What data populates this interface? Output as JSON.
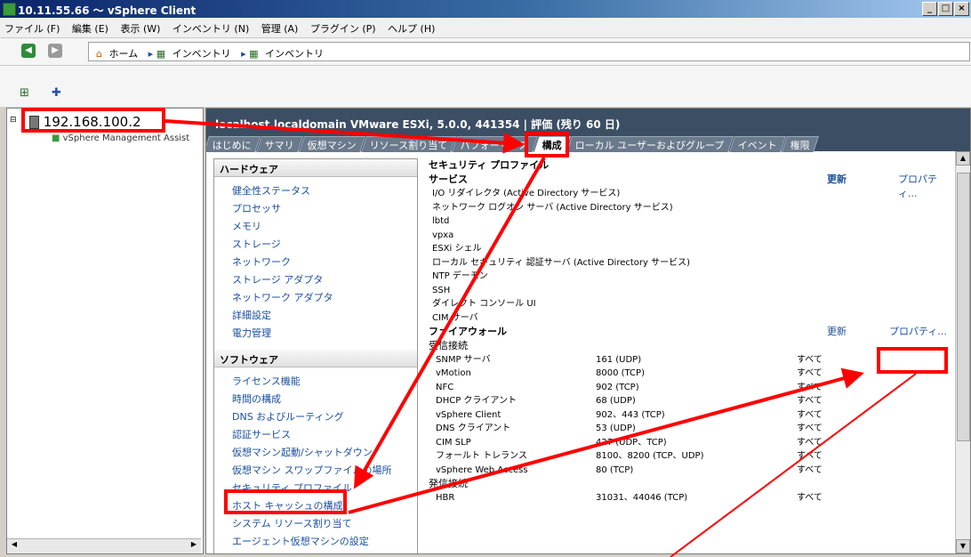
{
  "window": {
    "title": "10.11.55.66 ～ vSphere Client"
  },
  "menu": [
    "ファイル (F)",
    "編集 (E)",
    "表示 (W)",
    "インベントリ (N)",
    "管理 (A)",
    "プラグイン (P)",
    "ヘルプ (H)"
  ],
  "breadcrumb": {
    "home": "ホーム",
    "inv1": "インベントリ",
    "inv2": "インベントリ"
  },
  "tree": {
    "host": "192.168.100.2",
    "vm": "vSphere Management Assist"
  },
  "header": {
    "title": "localhost.localdomain VMware ESXi, 5.0.0, 441354 | 評価 (残り 60 日)"
  },
  "tabs": [
    "はじめに",
    "サマリ",
    "仮想マシン",
    "リソース割り当て",
    "パフォーマンス",
    "構成",
    "ローカル ユーザーおよびグループ",
    "イベント",
    "権限"
  ],
  "hardware": {
    "title": "ハードウェア",
    "items": [
      "健全性ステータス",
      "プロセッサ",
      "メモリ",
      "ストレージ",
      "ネットワーク",
      "ストレージ アダプタ",
      "ネットワーク アダプタ",
      "詳細設定",
      "電力管理"
    ]
  },
  "software": {
    "title": "ソフトウェア",
    "items": [
      "ライセンス機能",
      "時間の構成",
      "DNS およびルーティング",
      "認証サービス",
      "仮想マシン起動/シャットダウン",
      "仮想マシン スワップファイルの場所",
      "セキュリティ プロファイル",
      "ホスト キャッシュの構成",
      "システム リソース割り当て",
      "エージェント仮想マシンの設定"
    ]
  },
  "profile": {
    "title": "セキュリティ プロファイル",
    "services_title": "サービス",
    "refresh": "更新",
    "properties": "プロパティ...",
    "services": [
      "I/O リダイレクタ (Active Directory サービス)",
      "ネットワーク ログオン サーバ (Active Directory サービス)",
      "lbtd",
      "vpxa",
      "ESXi シェル",
      "ローカル セキュリティ 認証サーバ (Active Directory サービス)",
      "NTP デーモン",
      "SSH",
      "ダイレクト コンソール UI",
      "CIM サーバ"
    ],
    "firewall_title": "ファイアウォール",
    "incoming_title": "受信接続",
    "incoming": [
      {
        "name": "SNMP サーバ",
        "port": "161 (UDP)",
        "scope": "すべて"
      },
      {
        "name": "vMotion",
        "port": "8000 (TCP)",
        "scope": "すべて"
      },
      {
        "name": "NFC",
        "port": "902 (TCP)",
        "scope": "すべて"
      },
      {
        "name": "DHCP クライアント",
        "port": "68 (UDP)",
        "scope": "すべて"
      },
      {
        "name": "vSphere Client",
        "port": "902、443 (TCP)",
        "scope": "すべて"
      },
      {
        "name": "DNS クライアント",
        "port": "53 (UDP)",
        "scope": "すべて"
      },
      {
        "name": "CIM SLP",
        "port": "427 (UDP、TCP)",
        "scope": "すべて"
      },
      {
        "name": "フォールト トレランス",
        "port": "8100、8200 (TCP、UDP)",
        "scope": "すべて"
      },
      {
        "name": "vSphere Web Access",
        "port": "80 (TCP)",
        "scope": "すべて"
      }
    ],
    "outgoing_title": "発信接続",
    "outgoing": [
      {
        "name": "HBR",
        "port": "31031、44046 (TCP)",
        "scope": "すべて"
      }
    ]
  },
  "colors": {
    "annotation": "#ff0000",
    "header_bg": "#3c4e64",
    "link": "#1a4fa0"
  }
}
